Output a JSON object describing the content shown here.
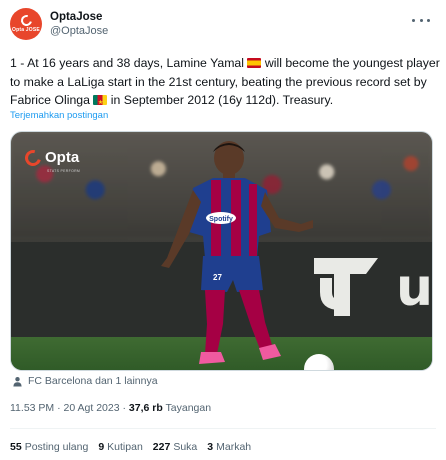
{
  "author": {
    "display_name": "OptaJose",
    "handle": "@OptaJose",
    "avatar_text": "Opta JOSE"
  },
  "tweet": {
    "text_1": "1 - At 16 years and 38 days, Lamine Yamal ",
    "text_2": " will become the youngest player to make a LaLiga start in the 21st century, beating the previous record set by Fabrice Olinga ",
    "text_3": " in September 2012 (16y 112d). Treasury.",
    "translate_link": "Terjemahkan postingan"
  },
  "media": {
    "watermark": "Opta",
    "watermark_sub": "STATS PERFORM",
    "board_letter": "u",
    "shirt_sponsor": "Spotify",
    "shirt_number": "27"
  },
  "tagged": "FC Barcelona dan 1 lainnya",
  "meta": {
    "time": "11.53 PM",
    "sep": " · ",
    "date": "20 Agt 2023",
    "views_count": "37,6 rb",
    "views_label": " Tayangan"
  },
  "stats": [
    {
      "count": "55",
      "label": "Posting ulang"
    },
    {
      "count": "9",
      "label": "Kutipan"
    },
    {
      "count": "227",
      "label": "Suka"
    },
    {
      "count": "3",
      "label": "Markah"
    }
  ],
  "colors": {
    "accent": "#1d9bf0",
    "opta": "#e8462b",
    "barca_blue": "#1f3f8f",
    "barca_red": "#a50044"
  }
}
